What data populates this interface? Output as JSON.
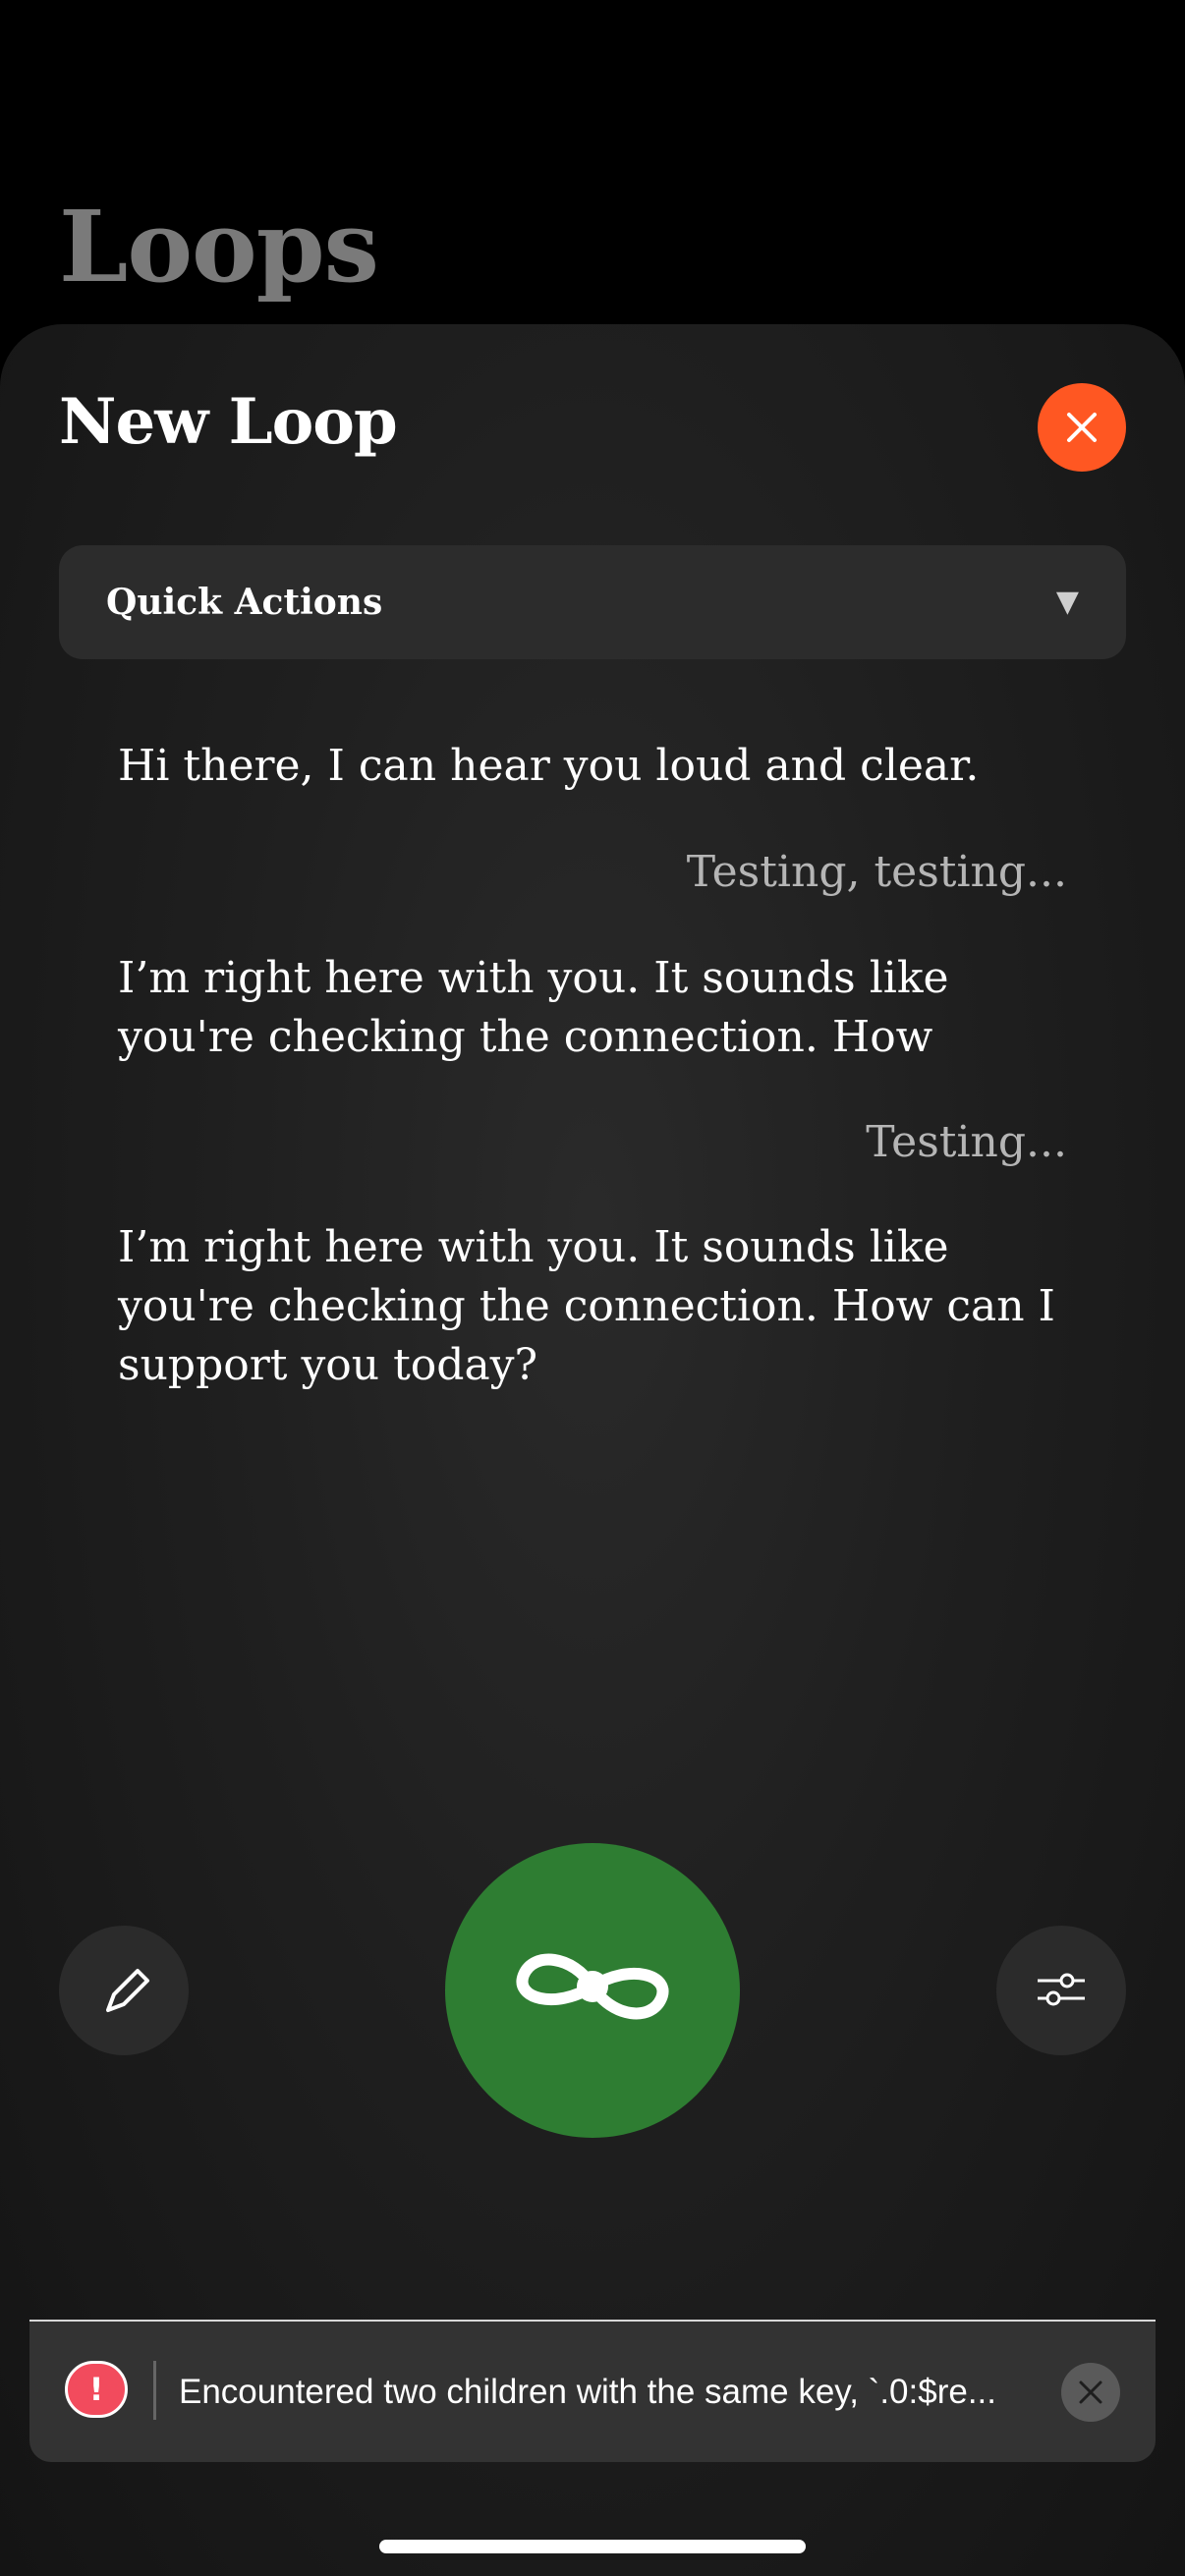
{
  "app": {
    "background_title": "Loops"
  },
  "sheet": {
    "title": "New Loop",
    "close_icon": "close-icon",
    "accent_color": "#ff5722"
  },
  "quick_actions": {
    "label": "Quick Actions",
    "caret": "▼"
  },
  "messages": [
    {
      "role": "assistant",
      "text": "Hi there, I can hear you loud and clear."
    },
    {
      "role": "user",
      "text": "Testing, testing..."
    },
    {
      "role": "assistant",
      "text": "I’m right here with you. It sounds like you're checking the connection. How"
    },
    {
      "role": "user",
      "text": "Testing..."
    },
    {
      "role": "assistant",
      "text": "I’m right here with you. It sounds like you're checking the connection. How can I support you today?"
    }
  ],
  "controls": {
    "left_icon": "pencil-icon",
    "center_icon": "loop-icon",
    "center_color": "#2e7d32",
    "right_icon": "sliders-icon"
  },
  "toast": {
    "icon": "!",
    "message": "Encountered two children with the same key, `.0:$re...",
    "close_icon": "close-icon",
    "icon_color": "#f24b5d"
  }
}
